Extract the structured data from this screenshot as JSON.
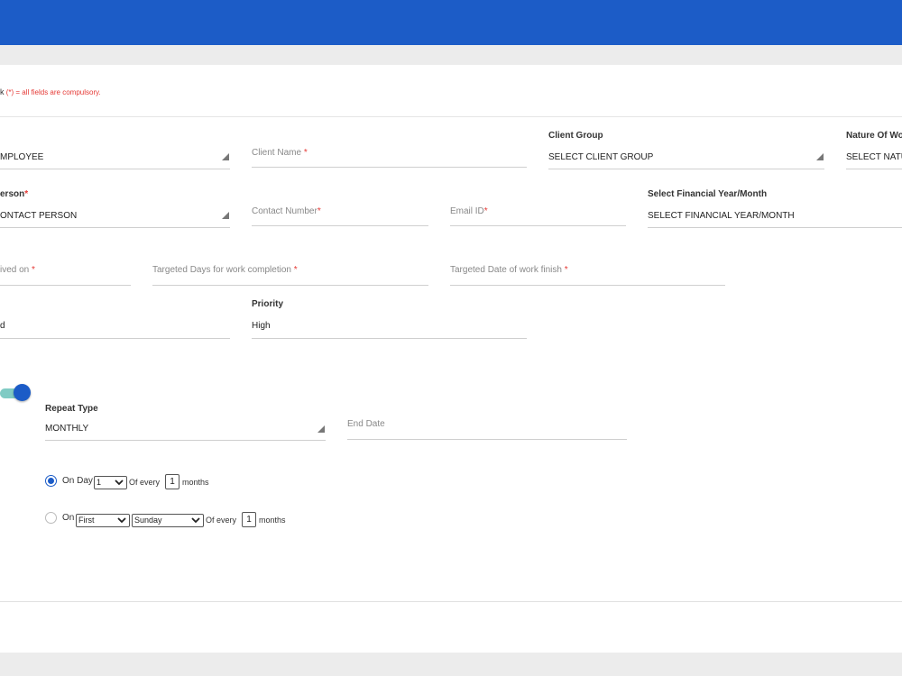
{
  "header": {
    "color": "#1c5cc7"
  },
  "note": {
    "prefix": "k",
    "text": "(*) = all fields are compulsory.",
    "color": "#e53935"
  },
  "row1": {
    "employee": {
      "value": "MPLOYEE"
    },
    "client_name": {
      "placeholder": "Client Name",
      "star": "*"
    },
    "client_group": {
      "label": "Client Group",
      "value": "SELECT CLIENT GROUP"
    },
    "nature_of_work": {
      "label": "Nature Of Wo",
      "value": "SELECT NATU"
    }
  },
  "row2": {
    "contact_person": {
      "label": "erson",
      "star": "*",
      "value": "ONTACT PERSON"
    },
    "contact_number": {
      "placeholder": "Contact Number",
      "star": "*"
    },
    "email": {
      "placeholder": "Email ID",
      "star": "*"
    },
    "financial_year": {
      "label": "Select Financial Year/Month",
      "value": "SELECT FINANCIAL YEAR/MONTH"
    }
  },
  "row3": {
    "received_on": {
      "placeholder": "ived on",
      "star": "*"
    },
    "targeted_days": {
      "placeholder": "Targeted Days for work completion",
      "star": "*"
    },
    "targeted_date": {
      "placeholder": "Targeted Date of work finish",
      "star": "*"
    }
  },
  "row4": {
    "partial": {
      "value": "d"
    },
    "priority": {
      "label": "Priority",
      "value": "High"
    }
  },
  "repeat": {
    "toggle_on": true,
    "repeat_type": {
      "label": "Repeat Type",
      "value": "MONTHLY"
    },
    "end_date": {
      "placeholder": "End Date"
    },
    "option1": {
      "label": "On Day",
      "day": "1",
      "of_every": "Of every",
      "count": "1",
      "unit": "months",
      "selected": true
    },
    "option2": {
      "label": "On",
      "ordinal": "First",
      "weekday": "Sunday",
      "of_every": "Of every",
      "count": "1",
      "unit": "months",
      "selected": false
    }
  }
}
